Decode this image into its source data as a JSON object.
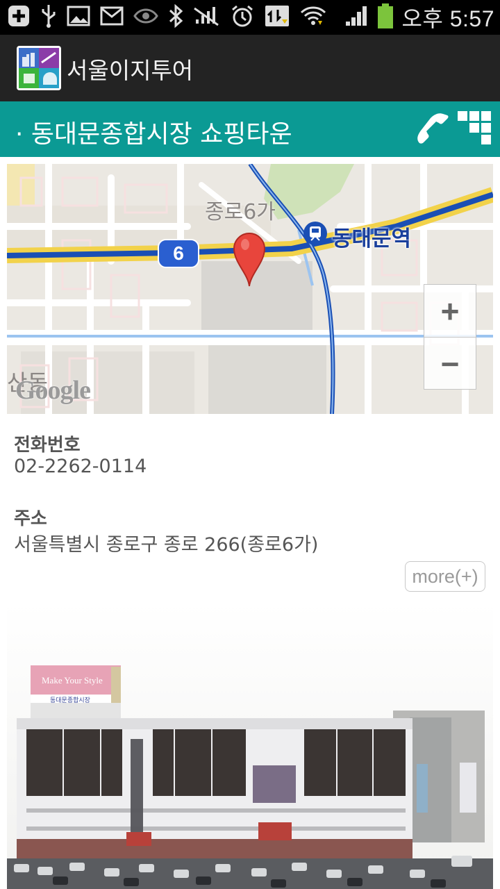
{
  "status_bar": {
    "time": "오후 5:57",
    "icons": [
      "add-icon",
      "usb-icon",
      "image-icon",
      "mail-icon",
      "eye-icon",
      "bluetooth-icon",
      "no-signal-icon",
      "alarm-icon",
      "data-sync-icon",
      "wifi-icon",
      "signal-icon",
      "battery-icon"
    ]
  },
  "app_bar": {
    "title": "서울이지투어"
  },
  "header": {
    "title": "· 동대문종합시장 쇼핑타운",
    "accent": "#0b9a94"
  },
  "map": {
    "labels": {
      "district": "종로6가",
      "station": "동대문역",
      "route": "6",
      "area": "산동"
    },
    "zoom_in": "+",
    "zoom_out": "−",
    "attribution": "Google"
  },
  "info": {
    "phone_label": "전화번호",
    "phone_value": "02-2262-0114",
    "address_label": "주소",
    "address_value": "서울특별시 종로구 종로 266(종로6가)",
    "more_label": "more(+)"
  },
  "photo": {
    "sign_top": "Make Your Style",
    "sign_small": "동대문종합시장"
  }
}
